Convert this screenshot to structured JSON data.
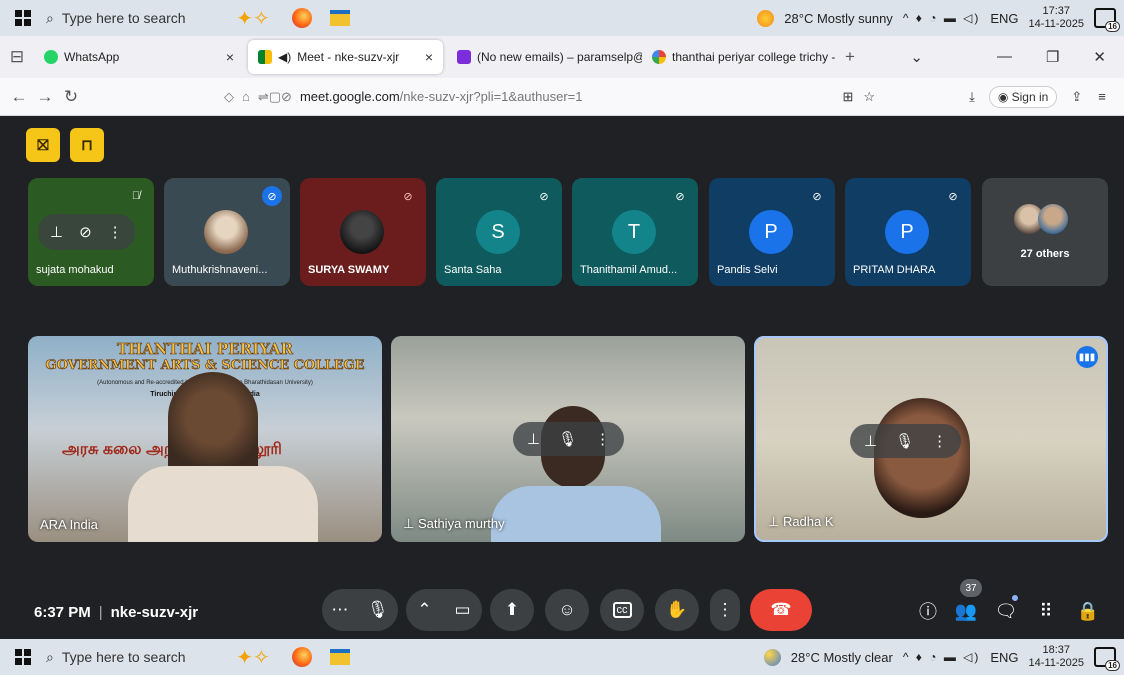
{
  "taskbar_top": {
    "search_placeholder": "Type here to search",
    "weather": "28°C  Mostly sunny",
    "lang": "ENG",
    "time": "17:37",
    "date": "14-11-2025",
    "notif_count": "16"
  },
  "taskbar_bottom": {
    "search_placeholder": "Type here to search",
    "weather": "28°C  Mostly clear",
    "lang": "ENG",
    "time": "18:37",
    "date": "14-11-2025",
    "notif_count": "16"
  },
  "tabs": [
    {
      "title": "WhatsApp",
      "close": "×"
    },
    {
      "title": "Meet - nke-suzv-xjr",
      "close": "×"
    },
    {
      "title": "(No new emails) – paramselp@",
      "close": "×"
    },
    {
      "title": "thanthai periyar college trichy -",
      "close": "×"
    }
  ],
  "new_tab": "+",
  "address": {
    "host": "meet.google.com",
    "path": "/nke-suzv-xjr?pli=1&authuser=1",
    "sign_in": "Sign in"
  },
  "participants": [
    {
      "name": "sujata mohakud",
      "bg": "#2b5a23",
      "initial": ""
    },
    {
      "name": "Muthukrishnaveni...",
      "bg": "#3a4a52",
      "initial": ""
    },
    {
      "name": "SURYA SWAMY",
      "bg": "#6b1d1d",
      "initial": ""
    },
    {
      "name": "Santa Saha",
      "bg": "#0e5a5d",
      "initial": "S",
      "avatar_color": "#12848a"
    },
    {
      "name": "Thanithamil Amud...",
      "bg": "#0e5a5d",
      "initial": "T",
      "avatar_color": "#12848a"
    },
    {
      "name": "Pandis Selvi",
      "bg": "#103d63",
      "initial": "P",
      "avatar_color": "#1a73e8"
    },
    {
      "name": "PRITAM DHARA",
      "bg": "#103d63",
      "initial": "P",
      "avatar_color": "#1a73e8"
    }
  ],
  "others": "27 others",
  "big_tiles": [
    {
      "name": "ARA India",
      "banner_line1": "THANTHAI PERIYAR",
      "banner_line2": "GOVERNMENT ARTS & SCIENCE COLLEGE",
      "banner_line3": "(Autonomous and Re-accredited by NAAC, Affiliated to Bharathidasan University)",
      "banner_line4": "Tiruchirappalli, Tamil Nadu, India",
      "tamil": "அரசு கலை அறிவியல் கல்லூரி"
    },
    {
      "name": "Sathiya murthy"
    },
    {
      "name": "Radha K"
    }
  ],
  "meeting": {
    "time": "6:37 PM",
    "code": "nke-suzv-xjr",
    "people_count": "37"
  },
  "colors": {
    "accent_yellow": "#f5c518",
    "end_call": "#ea4335",
    "page_bg": "#202124"
  }
}
